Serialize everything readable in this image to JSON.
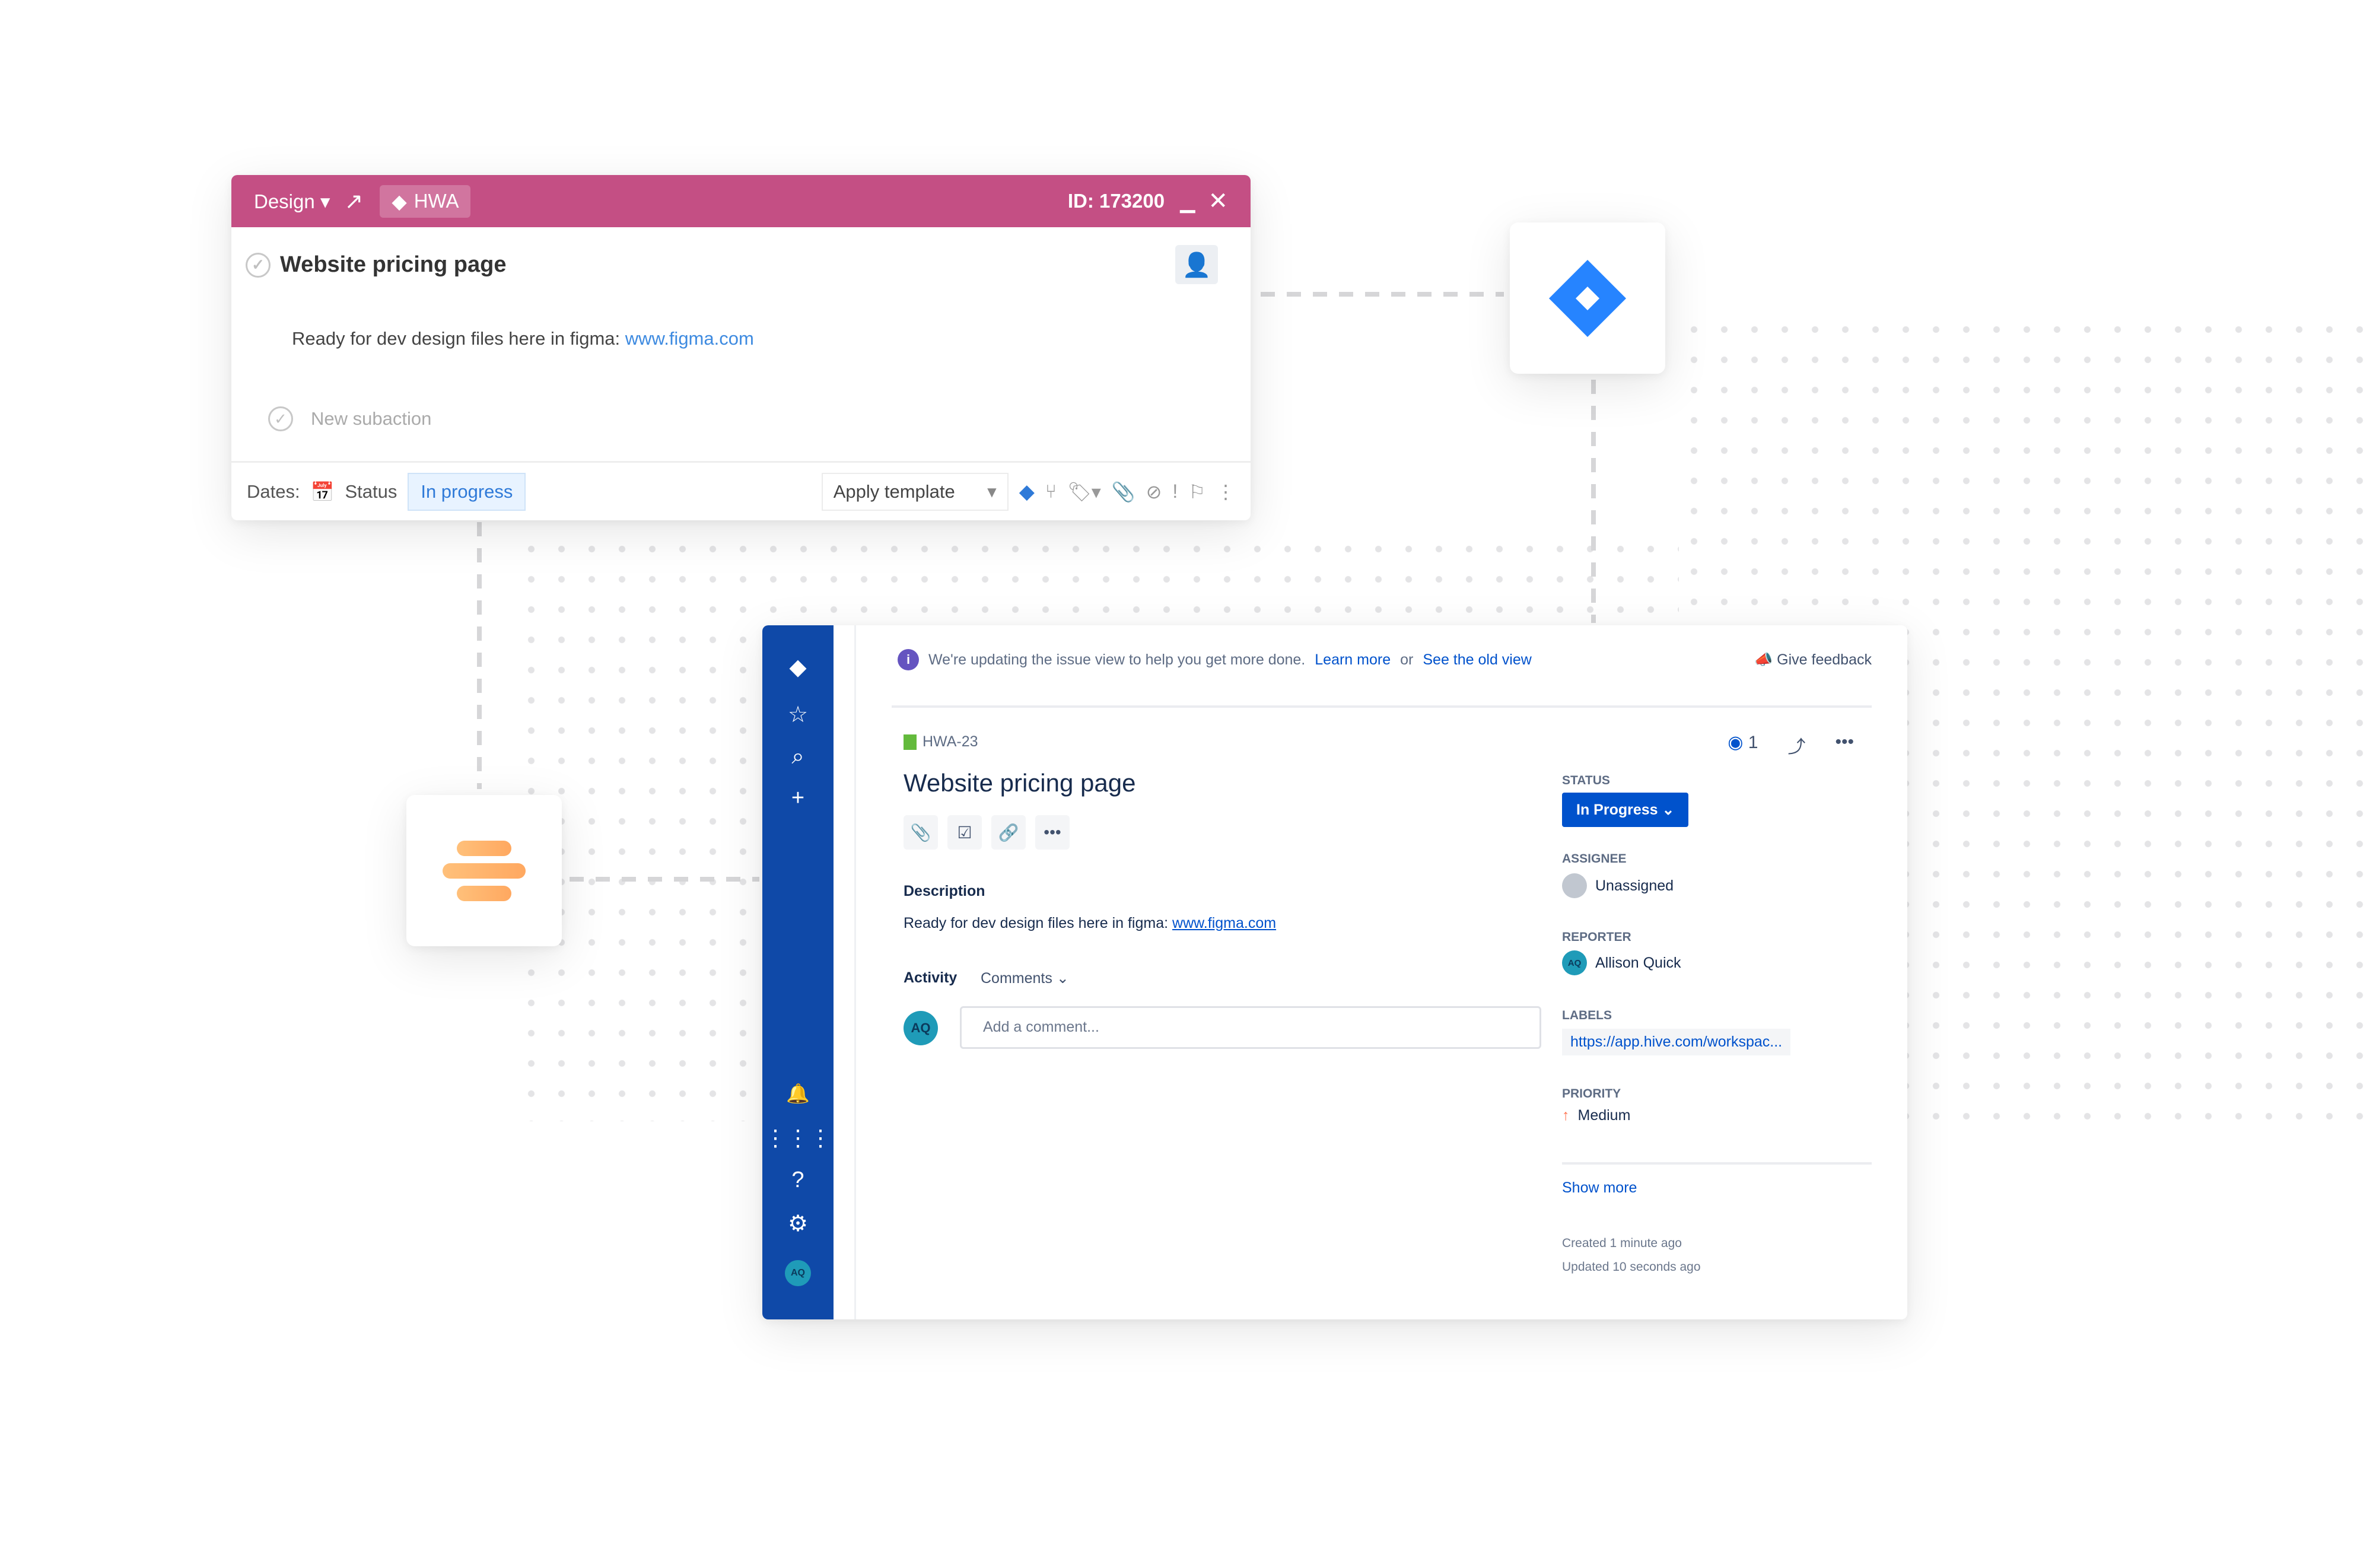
{
  "hive_card": {
    "project": "Design",
    "tag": "HWA",
    "id_label": "ID: 173200",
    "title": "Website pricing page",
    "description": "Ready for dev design files here in figma: ",
    "description_link": "www.figma.com",
    "new_subaction_placeholder": "New subaction",
    "dates_label": "Dates:",
    "status_label": "Status",
    "status_value": "In progress",
    "apply_template": "Apply template",
    "header_color": "#c44f84"
  },
  "jira": {
    "banner_text": "We're updating the issue view to help you get more done.",
    "learn_more": "Learn more",
    "or": "or",
    "old_view": "See the old view",
    "give_feedback": "Give feedback",
    "issue_key": "HWA-23",
    "watchers": "1",
    "title": "Website pricing page",
    "description_label": "Description",
    "description": "Ready for dev design files here in figma: ",
    "description_link": "www.figma.com",
    "activity_label": "Activity",
    "activity_filter": "Comments",
    "comment_placeholder": "Add a comment...",
    "avatar_initials": "AQ",
    "status_heading": "STATUS",
    "status_value": "In Progress",
    "assignee_heading": "ASSIGNEE",
    "assignee": "Unassigned",
    "reporter_heading": "REPORTER",
    "reporter": "Allison Quick",
    "labels_heading": "LABELS",
    "label_value": "https://app.hive.com/workspac...",
    "priority_heading": "PRIORITY",
    "priority": "Medium",
    "show_more": "Show more",
    "created": "Created 1 minute ago",
    "updated": "Updated 10 seconds ago",
    "accent": "#0052cc",
    "sidebar_color": "#0f49a8"
  }
}
